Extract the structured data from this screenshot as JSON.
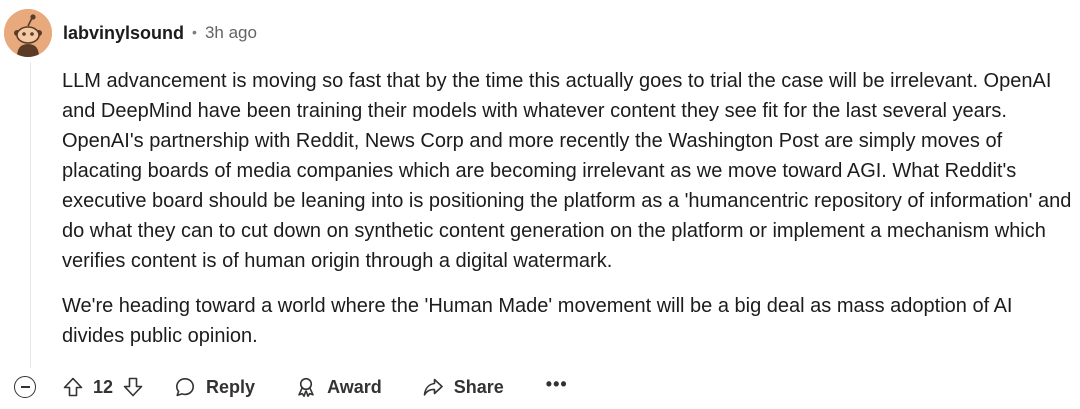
{
  "comment": {
    "author": "labvinylsound",
    "separator": "•",
    "time": "3h ago",
    "paragraphs": [
      "LLM advancement is moving so fast that by the time this actually goes to trial the case will be irrelevant. OpenAI and DeepMind have been training their models with whatever content they see fit for the last several years. OpenAI's partnership with Reddit, News Corp and more recently the Washington Post are simply moves of placating boards of media companies which are becoming irrelevant as we move toward AGI. What Reddit's executive board should be leaning into is positioning the platform as a 'humancentric repository of information' and do what they can to cut down on synthetic content generation on the platform or implement a mechanism which verifies content is of human origin through a digital watermark.",
      "We're heading toward a world where the 'Human Made' movement will be a big deal as mass adoption of AI divides public opinion."
    ]
  },
  "actions": {
    "vote_count": "12",
    "reply_label": "Reply",
    "award_label": "Award",
    "share_label": "Share",
    "more_label": "•••"
  },
  "icons": {
    "avatar": "reddit-snoo-avatar",
    "collapse": "collapse-minus-icon",
    "upvote": "arrow-up-icon",
    "downvote": "arrow-down-icon",
    "reply": "speech-bubble-icon",
    "award": "award-ribbon-icon",
    "share": "share-arrow-icon"
  },
  "colors": {
    "avatar_bg": "#e8aa7c",
    "text": "#1c1c1c",
    "muted": "#646464"
  }
}
